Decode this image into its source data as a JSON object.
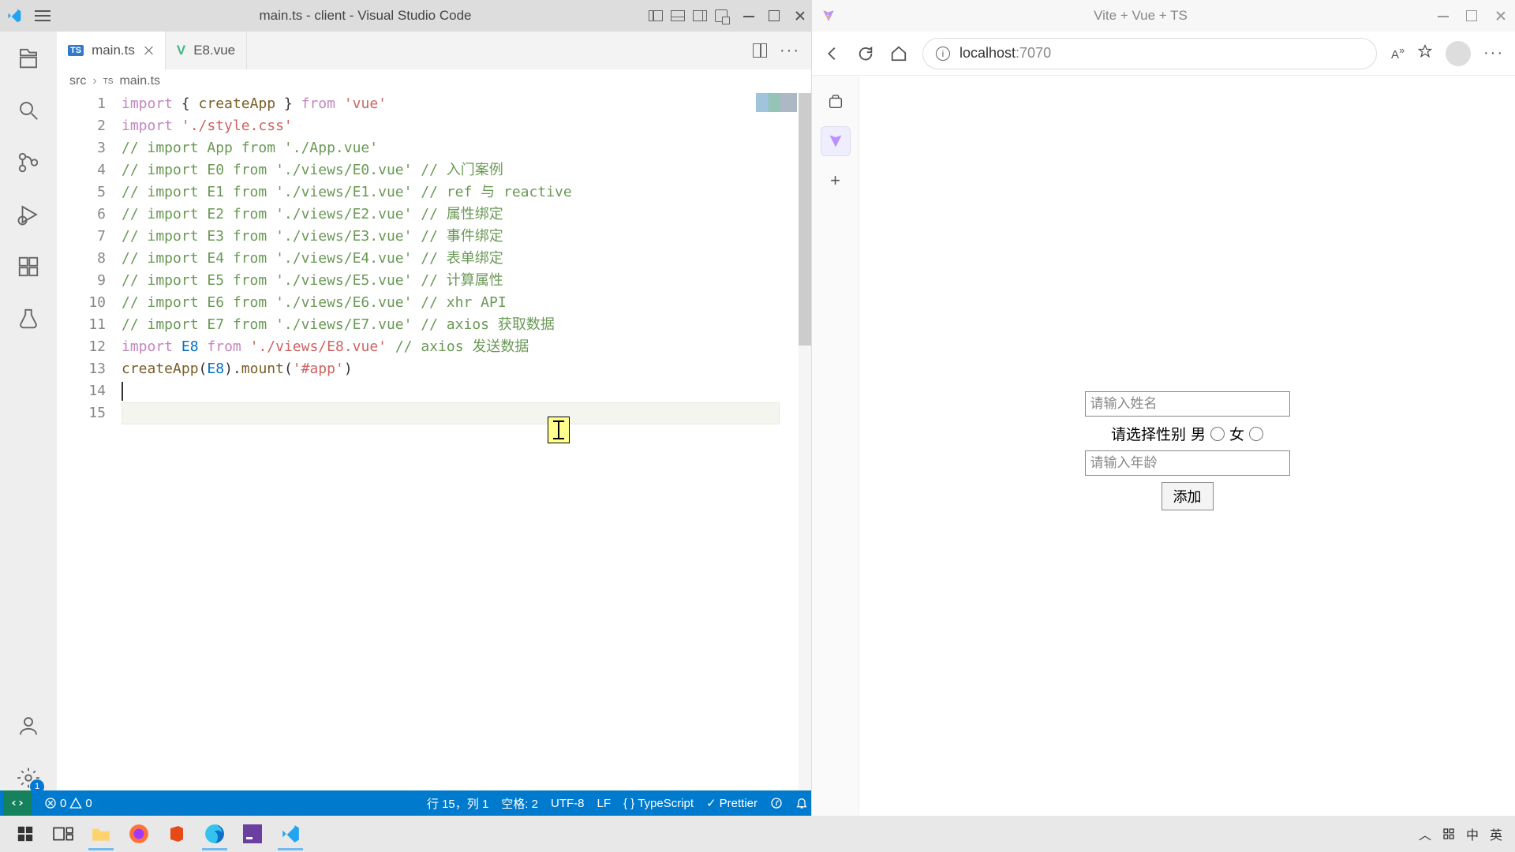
{
  "vscode": {
    "title": "main.ts - client - Visual Studio Code",
    "tabs": [
      {
        "icon": "TS",
        "label": "main.ts",
        "active": true
      },
      {
        "icon": "V",
        "label": "E8.vue",
        "active": false
      }
    ],
    "breadcrumb": {
      "folder": "src",
      "file": "main.ts"
    },
    "code_lines": [
      {
        "n": 1,
        "tokens": [
          [
            "kw-import",
            "import"
          ],
          [
            "punc",
            " { "
          ],
          [
            "fn",
            "createApp"
          ],
          [
            "punc",
            " } "
          ],
          [
            "kw-from",
            "from"
          ],
          [
            "punc",
            " "
          ],
          [
            "str",
            "'vue'"
          ]
        ]
      },
      {
        "n": 2,
        "tokens": [
          [
            "kw-import",
            "import"
          ],
          [
            "punc",
            " "
          ],
          [
            "str",
            "'./style.css'"
          ]
        ]
      },
      {
        "n": 3,
        "tokens": [
          [
            "comment",
            "// import App from './App.vue'"
          ]
        ]
      },
      {
        "n": 4,
        "tokens": [
          [
            "comment",
            "// import E0 from './views/E0.vue'  // 入门案例"
          ]
        ]
      },
      {
        "n": 5,
        "tokens": [
          [
            "comment",
            "// import E1 from './views/E1.vue'  // ref 与 reactive"
          ]
        ]
      },
      {
        "n": 6,
        "tokens": [
          [
            "comment",
            "// import E2 from './views/E2.vue'  // 属性绑定"
          ]
        ]
      },
      {
        "n": 7,
        "tokens": [
          [
            "comment",
            "// import E3 from './views/E3.vue'  // 事件绑定"
          ]
        ]
      },
      {
        "n": 8,
        "tokens": [
          [
            "comment",
            "// import E4 from './views/E4.vue'  // 表单绑定"
          ]
        ]
      },
      {
        "n": 9,
        "tokens": [
          [
            "comment",
            "// import E5 from './views/E5.vue'  // 计算属性"
          ]
        ]
      },
      {
        "n": 10,
        "tokens": [
          [
            "comment",
            "// import E6 from './views/E6.vue'  // xhr API"
          ]
        ]
      },
      {
        "n": 11,
        "tokens": [
          [
            "comment",
            "// import E7 from './views/E7.vue'  // axios 获取数据"
          ]
        ]
      },
      {
        "n": 12,
        "tokens": [
          [
            "kw-import",
            "import"
          ],
          [
            "punc",
            " "
          ],
          [
            "var",
            "E8"
          ],
          [
            "punc",
            " "
          ],
          [
            "kw-from",
            "from"
          ],
          [
            "punc",
            " "
          ],
          [
            "str",
            "'./views/E8.vue'"
          ],
          [
            "punc",
            "  "
          ],
          [
            "comment",
            "// axios 发送数据"
          ]
        ]
      },
      {
        "n": 13,
        "tokens": []
      },
      {
        "n": 14,
        "tokens": [
          [
            "fn",
            "createApp"
          ],
          [
            "punc",
            "("
          ],
          [
            "var",
            "E8"
          ],
          [
            "punc",
            ")."
          ],
          [
            "fn",
            "mount"
          ],
          [
            "punc",
            "("
          ],
          [
            "str",
            "'#app'"
          ],
          [
            "punc",
            ")"
          ]
        ]
      },
      {
        "n": 15,
        "tokens": []
      }
    ],
    "statusbar": {
      "errors": "0",
      "warnings": "0",
      "position": "行 15，列 1",
      "spaces": "空格: 2",
      "encoding": "UTF-8",
      "eol": "LF",
      "lang": "TypeScript",
      "prettier": "Prettier"
    },
    "settings_badge": "1"
  },
  "browser": {
    "title": "Vite + Vue + TS",
    "url_host": "localhost",
    "url_port": ":7070",
    "form": {
      "name_placeholder": "请输入姓名",
      "gender_label": "请选择性别",
      "male": "男",
      "female": "女",
      "age_placeholder": "请输入年龄",
      "submit": "添加"
    }
  },
  "taskbar": {
    "ime1": "中",
    "ime2": "英"
  }
}
